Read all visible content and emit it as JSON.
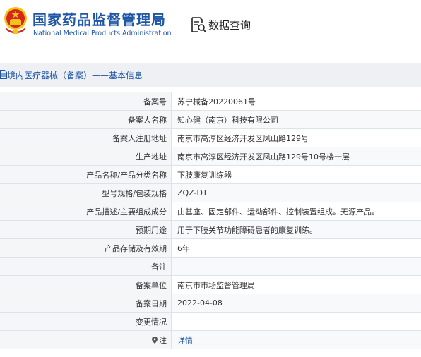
{
  "header": {
    "org_name_cn": "国家药品监督管理局",
    "org_name_en": "National Medical Products Administration",
    "search_title": "数据查询"
  },
  "breadcrumb": {
    "text": "境内医疗器械（备案）——基本信息"
  },
  "rows": [
    {
      "label": "备案号",
      "value": "苏宁械备20220061号"
    },
    {
      "label": "备案人名称",
      "value": "知心健（南京）科技有限公司"
    },
    {
      "label": "备案人注册地址",
      "value": "南京市高淳区经济开发区凤山路129号"
    },
    {
      "label": "生产地址",
      "value": "南京市高淳区经济开发区凤山路129号10号楼一层"
    },
    {
      "label": "产品名称/产品分类名称",
      "value": "下肢康复训练器"
    },
    {
      "label": "型号规格/包装规格",
      "value": "ZQZ-DT"
    },
    {
      "label": "产品描述/主要组成成分",
      "value": "由基座、固定部件、运动部件、控制装置组成。无源产品。"
    },
    {
      "label": "预期用途",
      "value": "用于下肢关节功能障碍患者的康复训练。"
    },
    {
      "label": "产品存储及有效期",
      "value": "6年"
    },
    {
      "label": "备注",
      "value": ""
    },
    {
      "label": "备案单位",
      "value": "南京市市场监督管理局"
    },
    {
      "label": "备案日期",
      "value": "2022-04-08"
    },
    {
      "label": "变更情况",
      "value": ""
    },
    {
      "label": "注",
      "value": "详情"
    }
  ],
  "colors": {
    "brand_blue": "#1f56a6",
    "emblem_red": "#d7261e",
    "emblem_gold": "#f2c418"
  }
}
